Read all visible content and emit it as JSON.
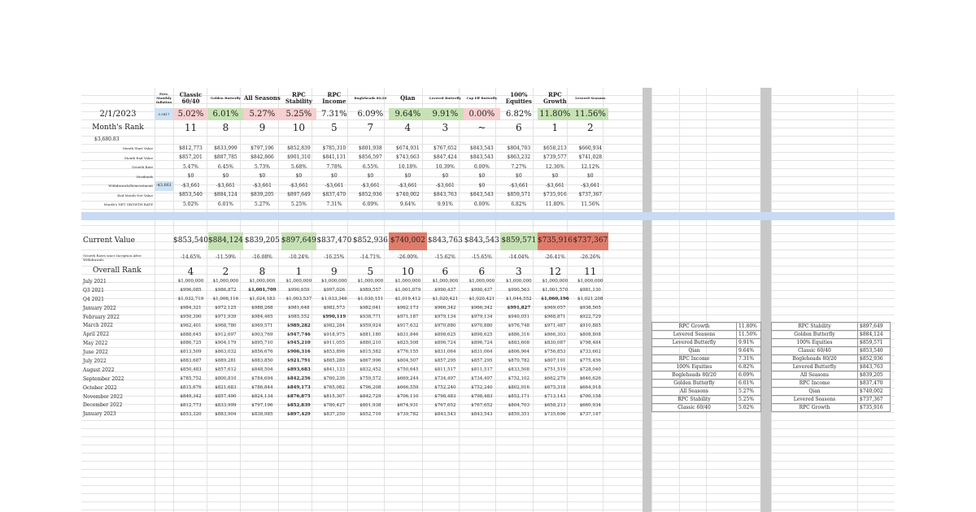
{
  "columns": [
    "Prev. Monthly Inflation",
    "Classic 60/40",
    "Golden Butterfly",
    "All Seasons",
    "RPC Stability",
    "RPC Income",
    "Bogleheads 80/20",
    "Qian",
    "Levered Butterfly",
    "Cap Eff Butterfly",
    "100% Equities",
    "RPC Growth",
    "Levered Seasons"
  ],
  "summary": {
    "date": "2/1/2023",
    "inflation": "0.5417",
    "growth": [
      "5.02%",
      "6.01%",
      "5.27%",
      "5.25%",
      "7.31%",
      "6.09%",
      "9.64%",
      "9.91%",
      "0.00%",
      "6.82%",
      "11.80%",
      "11.56%"
    ],
    "growth_class": [
      "pk",
      "g",
      "pk",
      "pk",
      "",
      "",
      "g",
      "g",
      "pk",
      "",
      "g",
      "g"
    ],
    "month_rank_label": "Month's Rank",
    "month_rank": [
      "11",
      "8",
      "9",
      "10",
      "5",
      "7",
      "4",
      "3",
      "~",
      "6",
      "1",
      "2"
    ],
    "cash_value": "$3,680.83"
  },
  "monthly_rows": [
    {
      "label": "Month Start Value",
      "values": [
        "$812,773",
        "$833,999",
        "$797,196",
        "$852,839",
        "$785,310",
        "$801,938",
        "$674,931",
        "$767,652",
        "$843,543",
        "$804,703",
        "$658,213",
        "$660,934"
      ]
    },
    {
      "label": "Month End Value",
      "values": [
        "$857,201",
        "$887,785",
        "$842,866",
        "$901,310",
        "$841,131",
        "$856,597",
        "$743,663",
        "$847,424",
        "$843,543",
        "$863,232",
        "$739,577",
        "$741,028"
      ]
    },
    {
      "label": "Growth Rate",
      "values": [
        "5.47%",
        "6.45%",
        "5.73%",
        "5.68%",
        "7.78%",
        "6.55%",
        "10.18%",
        "10.39%",
        "0.00%",
        "7.27%",
        "12.36%",
        "12.12%"
      ]
    },
    {
      "label": "Dividends",
      "values": [
        "$0",
        "$0",
        "$0",
        "$0",
        "$0",
        "$0",
        "$0",
        "$0",
        "$0",
        "$0",
        "$0",
        "$0"
      ]
    },
    {
      "label": "Withdrawals/Reinvestment",
      "lead": "-$3,661",
      "values": [
        "-$3,661",
        "-$3,661",
        "-$3,661",
        "-$3,661",
        "-$3,661",
        "-$3,661",
        "-$3,661",
        "-$3,661",
        "$0",
        "-$3,661",
        "-$3,661",
        "-$3,661"
      ]
    },
    {
      "label": "End Month Net Value",
      "values": [
        "$853,540",
        "$884,124",
        "$839,205",
        "$897,649",
        "$837,470",
        "$852,936",
        "$740,002",
        "$843,763",
        "$843,543",
        "$859,571",
        "$735,916",
        "$737,367"
      ]
    },
    {
      "label": "Month's NET GROWTH RATE",
      "values": [
        "5.02%",
        "6.01%",
        "5.27%",
        "5.25%",
        "7.31%",
        "6.09%",
        "9.64%",
        "9.91%",
        "0.00%",
        "6.82%",
        "11.80%",
        "11.56%"
      ]
    }
  ],
  "current": {
    "label": "Current Value",
    "values": [
      "$853,540",
      "$884,124",
      "$839,205",
      "$897,649",
      "$837,470",
      "$852,936",
      "$740,002",
      "$843,763",
      "$843,543",
      "$859,571",
      "$735,916",
      "$737,367"
    ],
    "classes": [
      "",
      "g",
      "",
      "g",
      "",
      "",
      "rd",
      "",
      "",
      "g",
      "rd",
      "rd"
    ]
  },
  "inception": {
    "label": "Growth Rates since Inception After Withdrawals",
    "values": [
      "-14.65%",
      "-11.59%",
      "-16.08%",
      "-10.24%",
      "-16.25%",
      "-14.71%",
      "-26.00%",
      "-15.62%",
      "-15.65%",
      "-14.04%",
      "-26.41%",
      "-26.26%"
    ]
  },
  "overall": {
    "label": "Overall Rank",
    "values": [
      "4",
      "2",
      "8",
      "1",
      "9",
      "5",
      "10",
      "6",
      "6",
      "3",
      "12",
      "11"
    ]
  },
  "history": [
    {
      "label": "July 2021",
      "values": [
        "$1,000,000",
        "$1,000,000",
        "$1,000,000",
        "$1,000,000",
        "$1,000,000",
        "$1,000,000",
        "$1,000,000",
        "$1,000,000",
        "$1,000,000",
        "$1,000,000",
        "$1,000,000",
        "$1,000,000"
      ],
      "bold": -1
    },
    {
      "label": "Q3 2021",
      "values": [
        "$996,085",
        "$986,872",
        "$1,001,709",
        "$990,659",
        "$997,026",
        "$989,557",
        "$1,001,079",
        "$990,437",
        "$990,437",
        "$990,563",
        "$1,001,570",
        "$981,130"
      ],
      "bold": 2
    },
    {
      "label": "Q4 2021",
      "values": [
        "$1,032,719",
        "$1,006,116",
        "$1,024,183",
        "$1,003,537",
        "$1,033,346",
        "$1,030,151",
        "$1,019,412",
        "$1,020,421",
        "$1,020,421",
        "$1,044,552",
        "$1,060,196",
        "$1,021,208"
      ],
      "bold": 10
    },
    {
      "label": "January 2022",
      "values": [
        "$984,321",
        "$972,125",
        "$988,268",
        "$981,648",
        "$982,573",
        "$982,041",
        "$962,173",
        "$966,342",
        "$966,342",
        "$991,827",
        "$969,057",
        "$938,505"
      ],
      "bold": 9
    },
    {
      "label": "February 2022",
      "values": [
        "$950,390",
        "$971,939",
        "$984,465",
        "$985,552",
        "$990,119",
        "$938,771",
        "$971,187",
        "$979,134",
        "$979,134",
        "$940,051",
        "$968,871",
        "$922,729"
      ],
      "bold": 4
    },
    {
      "label": "March 2022",
      "values": [
        "$962,401",
        "$968,780",
        "$969,571",
        "$989,282",
        "$982,284",
        "$959,924",
        "$917,632",
        "$970,880",
        "$970,880",
        "$976,748",
        "$971,487",
        "$910,885"
      ],
      "bold": 3
    },
    {
      "label": "April 2022",
      "values": [
        "$888,645",
        "$912,697",
        "$903,769",
        "$947,746",
        "$918,975",
        "$881,180",
        "$831,846",
        "$898,625",
        "$898,625",
        "$886,316",
        "$866,303",
        "$808,808"
      ],
      "bold": 3
    },
    {
      "label": "May 2022",
      "values": [
        "$886,725",
        "$904,179",
        "$895,710",
        "$945,210",
        "$911,055",
        "$880,210",
        "$825,508",
        "$896,724",
        "$896,724",
        "$883,608",
        "$830,087",
        "$798,484"
      ],
      "bold": 3
    },
    {
      "label": "June 2022",
      "values": [
        "$813,509",
        "$863,032",
        "$856,676",
        "$906,316",
        "$853,896",
        "$815,582",
        "$776,155",
        "$831,064",
        "$831,064",
        "$806,964",
        "$756,853",
        "$733,602"
      ],
      "bold": 3
    },
    {
      "label": "July 2022",
      "values": [
        "$883,687",
        "$889,281",
        "$883,850",
        "$921,791",
        "$885,286",
        "$867,996",
        "$804,507",
        "$857,295",
        "$857,295",
        "$870,782",
        "$807,191",
        "$775,456"
      ],
      "bold": 3
    },
    {
      "label": "August 2022",
      "values": [
        "$850,483",
        "$857,612",
        "$848,504",
        "$893,683",
        "$841,133",
        "$832,452",
        "$750,645",
        "$811,517",
        "$811,517",
        "$833,508",
        "$751,519",
        "$728,040"
      ],
      "bold": 3
    },
    {
      "label": "September 2022",
      "values": [
        "$785,752",
        "$800,810",
        "$784,694",
        "$842,256",
        "$760,236",
        "$759,572",
        "$669,244",
        "$734,497",
        "$734,497",
        "$752,102",
        "$662,279",
        "$646,626"
      ],
      "bold": 3
    },
    {
      "label": "October 2022",
      "values": [
        "$815,676",
        "$821,683",
        "$786,844",
        "$849,173",
        "$765,082",
        "$796,208",
        "$666,559",
        "$752,240",
        "$752,240",
        "$802,916",
        "$675,318",
        "$664,918"
      ],
      "bold": 3
    },
    {
      "label": "November 2022",
      "values": [
        "$849,342",
        "$857,490",
        "$824,134",
        "$876,875",
        "$815,307",
        "$842,729",
        "$706,110",
        "$798,483",
        "$798,483",
        "$852,171",
        "$713,143",
        "$700,158"
      ],
      "bold": 3
    },
    {
      "label": "December 2022",
      "values": [
        "$812,773",
        "$833,999",
        "$797,196",
        "$852,839",
        "$780,427",
        "$801,938",
        "$674,931",
        "$767,652",
        "$767,652",
        "$804,703",
        "$658,213",
        "$660,934"
      ],
      "bold": 3
    },
    {
      "label": "January 2023",
      "values": [
        "$853,320",
        "$883,904",
        "$838,985",
        "$897,429",
        "$837,250",
        "$852,716",
        "$739,782",
        "$843,543",
        "$843,543",
        "$859,351",
        "$735,696",
        "$737,147"
      ],
      "bold": 3
    }
  ],
  "ranking_growth": [
    [
      "RPC Growth",
      "11.80%"
    ],
    [
      "Levered Seasons",
      "11.56%"
    ],
    [
      "Levered Butterfly",
      "9.91%"
    ],
    [
      "Qian",
      "9.64%"
    ],
    [
      "RPC Income",
      "7.31%"
    ],
    [
      "100% Equities",
      "6.82%"
    ],
    [
      "Bogleheads 80/20",
      "6.09%"
    ],
    [
      "Golden Butterfly",
      "6.01%"
    ],
    [
      "All Seasons",
      "5.27%"
    ],
    [
      "RPC Stability",
      "5.25%"
    ],
    [
      "Classic 60/40",
      "5.02%"
    ]
  ],
  "ranking_value": [
    [
      "RPC Stability",
      "$897,649"
    ],
    [
      "Golden Butterfly",
      "$884,124"
    ],
    [
      "100% Equities",
      "$859,571"
    ],
    [
      "Classic 60/40",
      "$853,540"
    ],
    [
      "Bogleheads 80/20",
      "$852,936"
    ],
    [
      "Levered Butterfly",
      "$843,763"
    ],
    [
      "All Seasons",
      "$839,205"
    ],
    [
      "RPC Income",
      "$837,470"
    ],
    [
      "Qian",
      "$740,002"
    ],
    [
      "Levered Seasons",
      "$737,367"
    ],
    [
      "RPC Growth",
      "$735,916"
    ]
  ]
}
